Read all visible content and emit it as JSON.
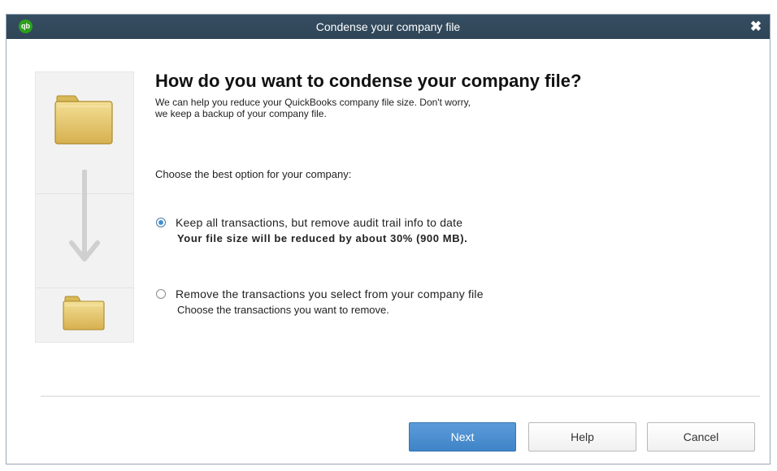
{
  "window": {
    "title": "Condense your company file",
    "logo_text": "qb",
    "close_glyph": "✖"
  },
  "main": {
    "heading": "How do you want to condense your company file?",
    "intro_line1": "We can help you reduce your QuickBooks company file size. Don't worry,",
    "intro_line2": "we keep a backup of your company file.",
    "choose_label": "Choose the best option for your company:",
    "options": [
      {
        "label": "Keep all transactions, but remove audit trail info to date",
        "sub": "Your file size will be reduced by about 30% (900 MB).",
        "selected": true
      },
      {
        "label": "Remove the transactions you select from your company file",
        "sub": "Choose the transactions you want to remove.",
        "selected": false
      }
    ]
  },
  "side_panel": {
    "icons": [
      "folder-icon",
      "down-arrow-icon",
      "folder-icon"
    ]
  },
  "buttons": {
    "next": "Next",
    "help": "Help",
    "cancel": "Cancel"
  },
  "colors": {
    "titlebar": "#2f4557",
    "accent_button": "#4a8ed0",
    "folder_fill": "#e3c86a"
  }
}
